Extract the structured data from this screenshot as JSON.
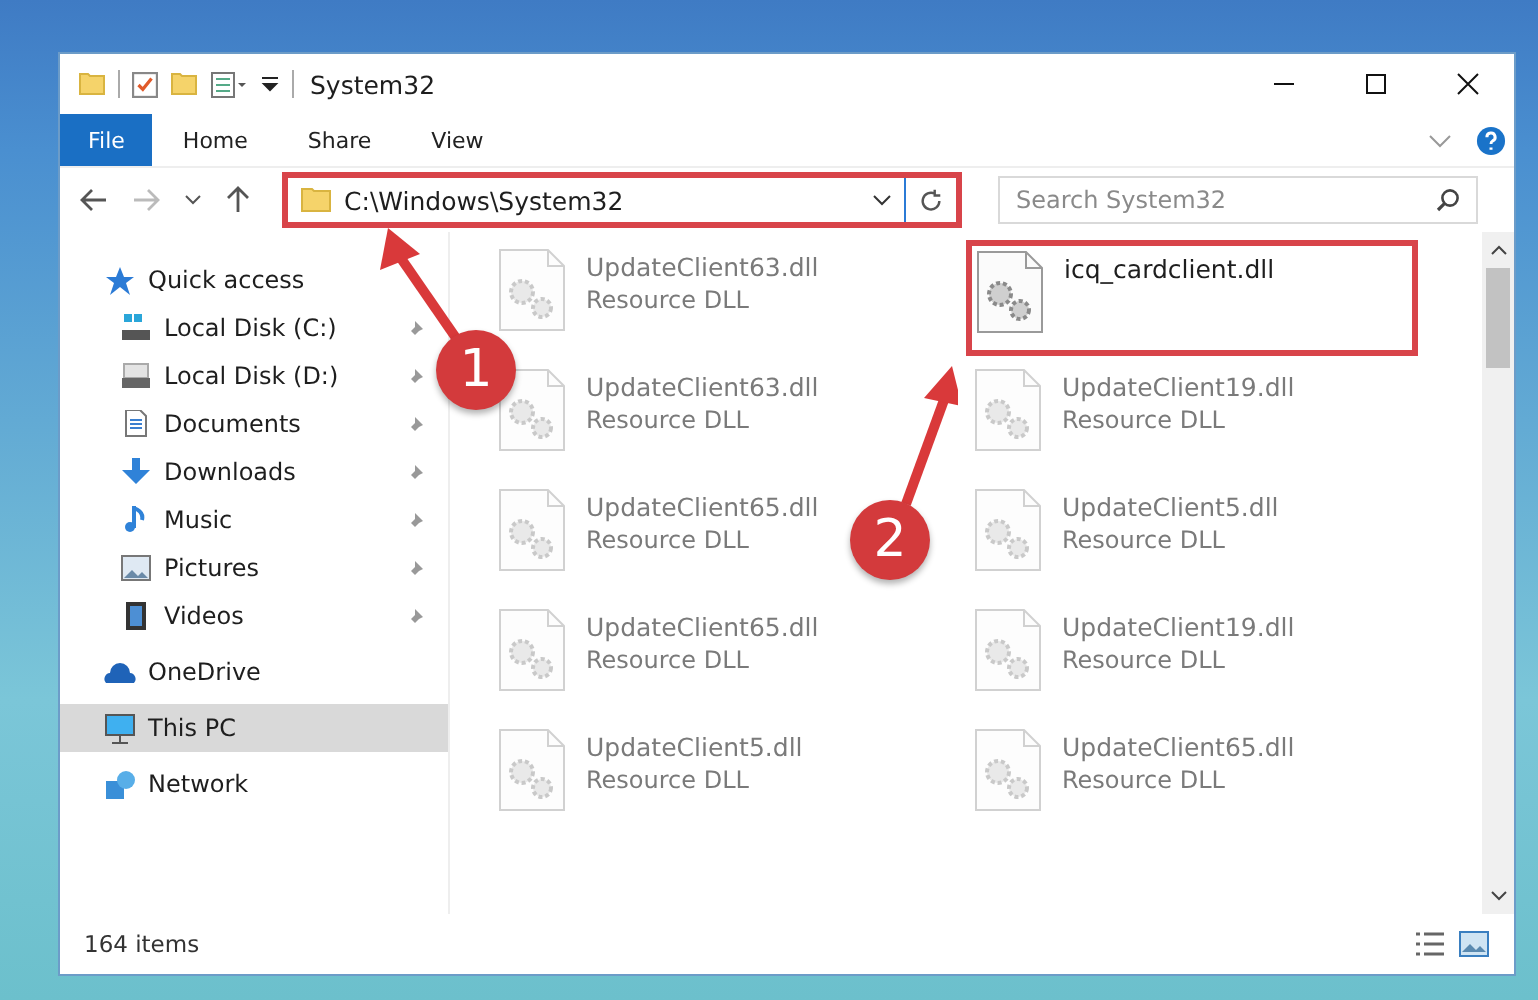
{
  "window": {
    "title": "System32"
  },
  "ribbon": {
    "tabs": [
      {
        "label": "File",
        "selected": true
      },
      {
        "label": "Home",
        "selected": false
      },
      {
        "label": "Share",
        "selected": false
      },
      {
        "label": "View",
        "selected": false
      }
    ]
  },
  "address": {
    "path": "C:\\Windows\\System32",
    "highlighted": true
  },
  "search": {
    "placeholder": "Search System32"
  },
  "sidebar": {
    "items": [
      {
        "label": "Quick access",
        "selected": false,
        "children": [
          {
            "label": "Local Disk (C:)",
            "pinned": true,
            "selected": false
          },
          {
            "label": "Local Disk (D:)",
            "pinned": true,
            "selected": false
          },
          {
            "label": "Documents",
            "pinned": true,
            "selected": false
          },
          {
            "label": "Downloads",
            "pinned": true,
            "selected": false
          },
          {
            "label": "Music",
            "pinned": true,
            "selected": false
          },
          {
            "label": "Pictures",
            "pinned": true,
            "selected": false
          },
          {
            "label": "Videos",
            "pinned": true,
            "selected": false
          }
        ]
      },
      {
        "label": "OneDrive",
        "selected": false
      },
      {
        "label": "This PC",
        "selected": true
      },
      {
        "label": "Network",
        "selected": false
      }
    ]
  },
  "files": [
    {
      "name": "UpdateClient63.dll",
      "type": "Resource DLL",
      "dimmed": true,
      "highlighted": false
    },
    {
      "name": "icq_cardclient.dll",
      "dimmed": false,
      "highlighted": true
    },
    {
      "name": "UpdateClient63.dll",
      "type": "Resource DLL",
      "dimmed": true,
      "highlighted": false
    },
    {
      "name": "UpdateClient19.dll",
      "type": "Resource DLL",
      "dimmed": true,
      "highlighted": false
    },
    {
      "name": "UpdateClient65.dll",
      "type": "Resource DLL",
      "dimmed": true,
      "highlighted": false
    },
    {
      "name": "UpdateClient5.dll",
      "type": "Resource DLL",
      "dimmed": true,
      "highlighted": false
    },
    {
      "name": "UpdateClient65.dll",
      "type": "Resource DLL",
      "dimmed": true,
      "highlighted": false
    },
    {
      "name": "UpdateClient19.dll",
      "type": "Resource DLL",
      "dimmed": true,
      "highlighted": false
    },
    {
      "name": "UpdateClient5.dll",
      "type": "Resource DLL",
      "dimmed": true,
      "highlighted": false
    },
    {
      "name": "UpdateClient65.dll",
      "type": "Resource DLL",
      "dimmed": true,
      "highlighted": false
    }
  ],
  "status_bar": {
    "item_count": "164 items"
  },
  "annotations": [
    {
      "number": "1"
    },
    {
      "number": "2"
    }
  ]
}
